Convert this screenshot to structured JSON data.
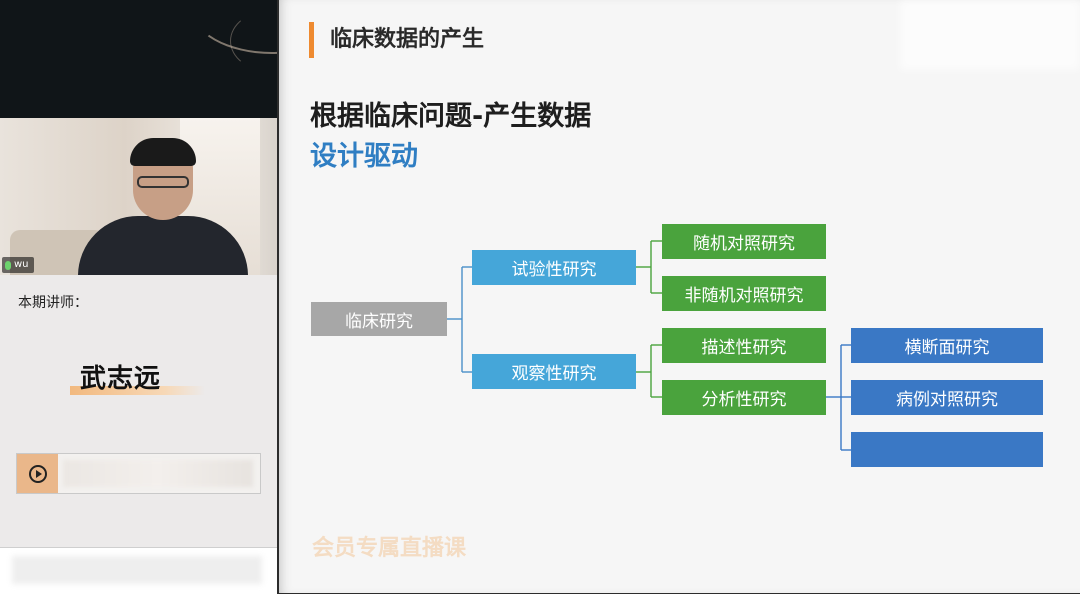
{
  "participant": {
    "name": "wu"
  },
  "lecturer": {
    "label": "本期讲师：",
    "name": "武志远"
  },
  "slide": {
    "title": "临床数据的产生",
    "heading_primary": "根据临床问题-产生数据",
    "heading_secondary": "设计驱动",
    "watermark": "会员专属直播课",
    "tree": {
      "root": "临床研究",
      "experimental": "试验性研究",
      "observational": "观察性研究",
      "randomized": "随机对照研究",
      "non_randomized": "非随机对照研究",
      "descriptive": "描述性研究",
      "analytical": "分析性研究",
      "cross_sectional": "横断面研究",
      "case_control": "病例对照研究",
      "third_analytic": ""
    }
  },
  "colors": {
    "accent": "#ee8a30",
    "heading_blue": "#2f7ec3",
    "node_gray": "#a7a7a7",
    "node_cyan": "#45a6d9",
    "node_green": "#4aa33d",
    "node_blue": "#3a78c5"
  }
}
